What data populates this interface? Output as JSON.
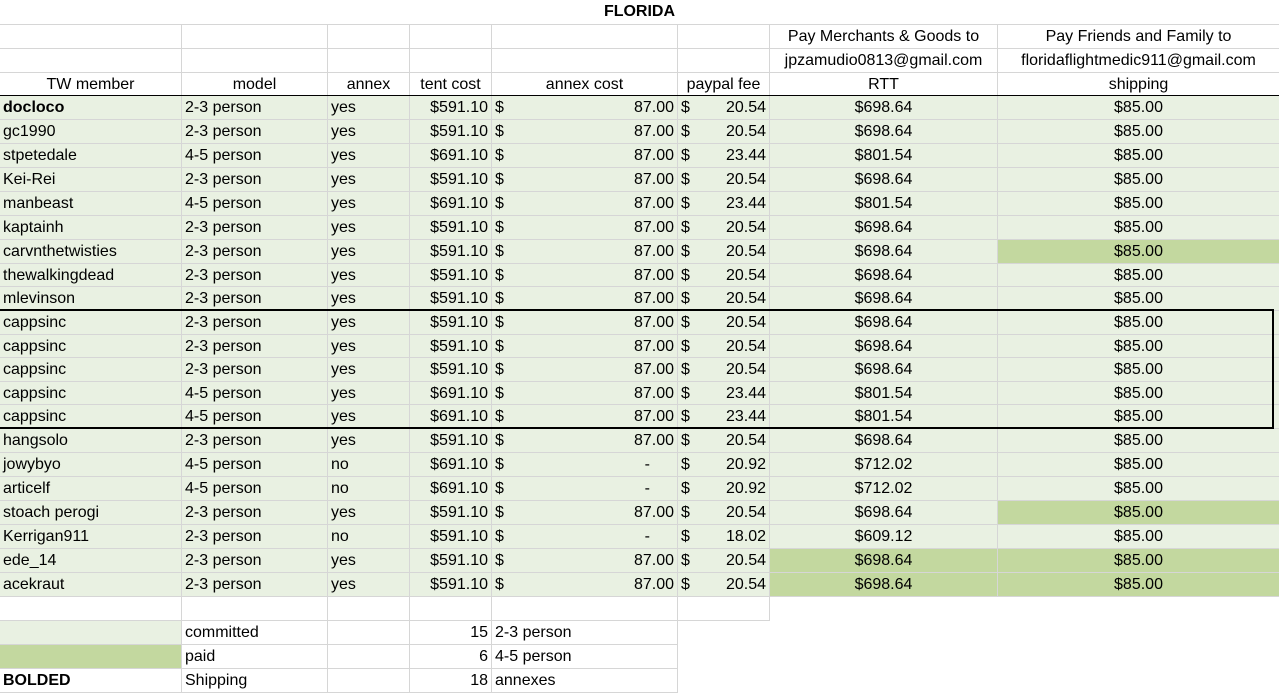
{
  "title": "FLORIDA",
  "payment_headers": {
    "merchants_label": "Pay Merchants & Goods  to",
    "merchants_email": "jpzamudio0813@gmail.com",
    "friends_label": "Pay Friends and Family to",
    "friends_email": "floridaflightmedic911@gmail.com"
  },
  "columns": [
    "TW member",
    "model",
    "annex",
    "tent cost",
    "annex cost",
    "paypal fee",
    "RTT",
    "shipping"
  ],
  "rows": [
    {
      "member": "docloco",
      "model": "2-3 person",
      "annex": "yes",
      "tent": "$591.10",
      "annex_cost": "87.00",
      "fee": "20.54",
      "rtt": "$698.64",
      "shipping": "$85.00",
      "bold": true,
      "rtt_paid": false,
      "ship_paid": false
    },
    {
      "member": "gc1990",
      "model": "2-3 person",
      "annex": "yes",
      "tent": "$591.10",
      "annex_cost": "87.00",
      "fee": "20.54",
      "rtt": "$698.64",
      "shipping": "$85.00",
      "bold": false,
      "rtt_paid": false,
      "ship_paid": false
    },
    {
      "member": "stpetedale",
      "model": "4-5 person",
      "annex": "yes",
      "tent": "$691.10",
      "annex_cost": "87.00",
      "fee": "23.44",
      "rtt": "$801.54",
      "shipping": "$85.00",
      "bold": false,
      "rtt_paid": false,
      "ship_paid": false
    },
    {
      "member": "Kei-Rei",
      "model": "2-3 person",
      "annex": "yes",
      "tent": "$591.10",
      "annex_cost": "87.00",
      "fee": "20.54",
      "rtt": "$698.64",
      "shipping": "$85.00",
      "bold": false,
      "rtt_paid": false,
      "ship_paid": false
    },
    {
      "member": "manbeast",
      "model": "4-5 person",
      "annex": "yes",
      "tent": "$691.10",
      "annex_cost": "87.00",
      "fee": "23.44",
      "rtt": "$801.54",
      "shipping": "$85.00",
      "bold": false,
      "rtt_paid": false,
      "ship_paid": false
    },
    {
      "member": "kaptainh",
      "model": "2-3 person",
      "annex": "yes",
      "tent": "$591.10",
      "annex_cost": "87.00",
      "fee": "20.54",
      "rtt": "$698.64",
      "shipping": "$85.00",
      "bold": false,
      "rtt_paid": false,
      "ship_paid": false
    },
    {
      "member": "carvnthetwisties",
      "model": "2-3 person",
      "annex": "yes",
      "tent": "$591.10",
      "annex_cost": "87.00",
      "fee": "20.54",
      "rtt": "$698.64",
      "shipping": "$85.00",
      "bold": false,
      "rtt_paid": false,
      "ship_paid": true
    },
    {
      "member": "thewalkingdead",
      "model": "2-3 person",
      "annex": "yes",
      "tent": "$591.10",
      "annex_cost": "87.00",
      "fee": "20.54",
      "rtt": "$698.64",
      "shipping": "$85.00",
      "bold": false,
      "rtt_paid": false,
      "ship_paid": false
    },
    {
      "member": "mlevinson",
      "model": "2-3 person",
      "annex": "yes",
      "tent": "$591.10",
      "annex_cost": "87.00",
      "fee": "20.54",
      "rtt": "$698.64",
      "shipping": "$85.00",
      "bold": false,
      "rtt_paid": false,
      "ship_paid": false
    },
    {
      "member": "cappsinc",
      "model": "2-3 person",
      "annex": "yes",
      "tent": "$591.10",
      "annex_cost": "87.00",
      "fee": "20.54",
      "rtt": "$698.64",
      "shipping": "$85.00",
      "bold": false,
      "rtt_paid": false,
      "ship_paid": false
    },
    {
      "member": "cappsinc",
      "model": "2-3 person",
      "annex": "yes",
      "tent": "$591.10",
      "annex_cost": "87.00",
      "fee": "20.54",
      "rtt": "$698.64",
      "shipping": "$85.00",
      "bold": false,
      "rtt_paid": false,
      "ship_paid": false
    },
    {
      "member": "cappsinc",
      "model": "2-3 person",
      "annex": "yes",
      "tent": "$591.10",
      "annex_cost": "87.00",
      "fee": "20.54",
      "rtt": "$698.64",
      "shipping": "$85.00",
      "bold": false,
      "rtt_paid": false,
      "ship_paid": false
    },
    {
      "member": "cappsinc",
      "model": "4-5 person",
      "annex": "yes",
      "tent": "$691.10",
      "annex_cost": "87.00",
      "fee": "23.44",
      "rtt": "$801.54",
      "shipping": "$85.00",
      "bold": false,
      "rtt_paid": false,
      "ship_paid": false
    },
    {
      "member": "cappsinc",
      "model": "4-5 person",
      "annex": "yes",
      "tent": "$691.10",
      "annex_cost": "87.00",
      "fee": "23.44",
      "rtt": "$801.54",
      "shipping": "$85.00",
      "bold": false,
      "rtt_paid": false,
      "ship_paid": false
    },
    {
      "member": "hangsolo",
      "model": "2-3 person",
      "annex": "yes",
      "tent": "$591.10",
      "annex_cost": "87.00",
      "fee": "20.54",
      "rtt": "$698.64",
      "shipping": "$85.00",
      "bold": false,
      "rtt_paid": false,
      "ship_paid": false
    },
    {
      "member": "jowybyo",
      "model": "4-5 person",
      "annex": "no",
      "tent": "$691.10",
      "annex_cost": "-",
      "fee": "20.92",
      "rtt": "$712.02",
      "shipping": "$85.00",
      "bold": false,
      "rtt_paid": false,
      "ship_paid": false
    },
    {
      "member": "articelf",
      "model": "4-5 person",
      "annex": "no",
      "tent": "$691.10",
      "annex_cost": "-",
      "fee": "20.92",
      "rtt": "$712.02",
      "shipping": "$85.00",
      "bold": false,
      "rtt_paid": false,
      "ship_paid": false
    },
    {
      "member": "stoach perogi",
      "model": "2-3 person",
      "annex": "yes",
      "tent": "$591.10",
      "annex_cost": "87.00",
      "fee": "20.54",
      "rtt": "$698.64",
      "shipping": "$85.00",
      "bold": false,
      "rtt_paid": false,
      "ship_paid": true
    },
    {
      "member": "Kerrigan911",
      "model": "2-3 person",
      "annex": "no",
      "tent": "$591.10",
      "annex_cost": "-",
      "fee": "18.02",
      "rtt": "$609.12",
      "shipping": "$85.00",
      "bold": false,
      "rtt_paid": false,
      "ship_paid": false
    },
    {
      "member": "ede_14",
      "model": "2-3 person",
      "annex": "yes",
      "tent": "$591.10",
      "annex_cost": "87.00",
      "fee": "20.54",
      "rtt": "$698.64",
      "shipping": "$85.00",
      "bold": false,
      "rtt_paid": true,
      "ship_paid": true
    },
    {
      "member": "acekraut",
      "model": "2-3 person",
      "annex": "yes",
      "tent": "$591.10",
      "annex_cost": "87.00",
      "fee": "20.54",
      "rtt": "$698.64",
      "shipping": "$85.00",
      "bold": false,
      "rtt_paid": true,
      "ship_paid": true
    }
  ],
  "currency_symbol": "$",
  "legend": [
    {
      "label": "committed",
      "count": "15",
      "desc": "2-3 person",
      "swatch": "#e9f1e2"
    },
    {
      "label": "paid",
      "count": "6",
      "desc": "4-5 person",
      "swatch": "#c3d89f"
    },
    {
      "label": "Shipping",
      "count": "18",
      "desc": "annexes",
      "swatch_text": "BOLDED"
    }
  ],
  "colors": {
    "committed": "#e9f1e2",
    "paid": "#c3d89f"
  }
}
